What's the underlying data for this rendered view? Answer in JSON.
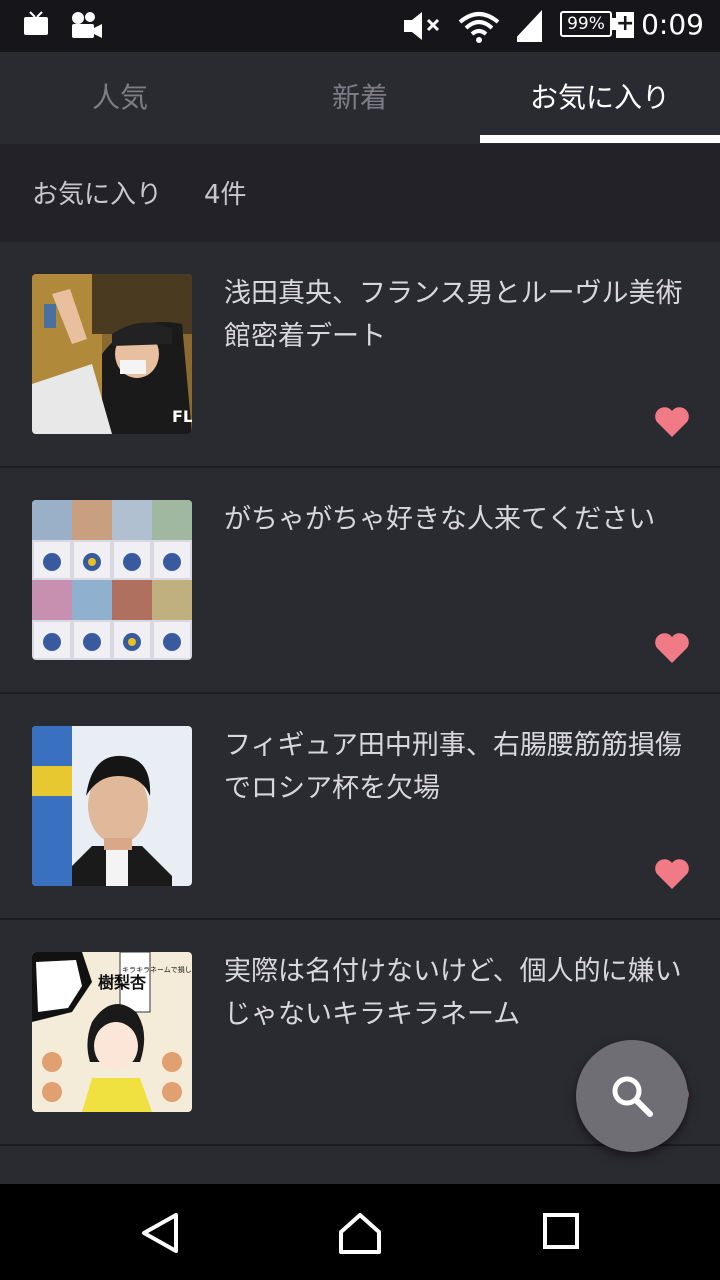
{
  "status_bar": {
    "time": "0:09",
    "battery": "99%",
    "icons": [
      "tv-icon",
      "video-icon",
      "mute-icon",
      "wifi-icon",
      "signal-icon",
      "battery-icon"
    ]
  },
  "tabs": [
    {
      "label": "人気",
      "active": false
    },
    {
      "label": "新着",
      "active": false
    },
    {
      "label": "お気に入り",
      "active": true
    }
  ],
  "section": {
    "title": "お気に入り",
    "count": "4件"
  },
  "items": [
    {
      "title": "浅田真央、フランス男とルーヴル美術館密着デート",
      "favorite": true
    },
    {
      "title": "がちゃがちゃ好きな人来てください",
      "favorite": true
    },
    {
      "title": "フィギュア田中刑事、右腸腰筋筋損傷でロシア杯を欠場",
      "favorite": true
    },
    {
      "title": "実際は名付けないけど、個人的に嫌いじゃないキラキラネーム",
      "favorite": true
    }
  ],
  "thumb_text": {
    "t1": "FLA",
    "t4_a": "樹梨杏",
    "t4_b": "キラキラネームで損したことは?"
  },
  "colors": {
    "background": "#2a2a31",
    "heart": "#f07a86",
    "tab_indicator": "#ffffff",
    "fab": "#6e6e74"
  }
}
